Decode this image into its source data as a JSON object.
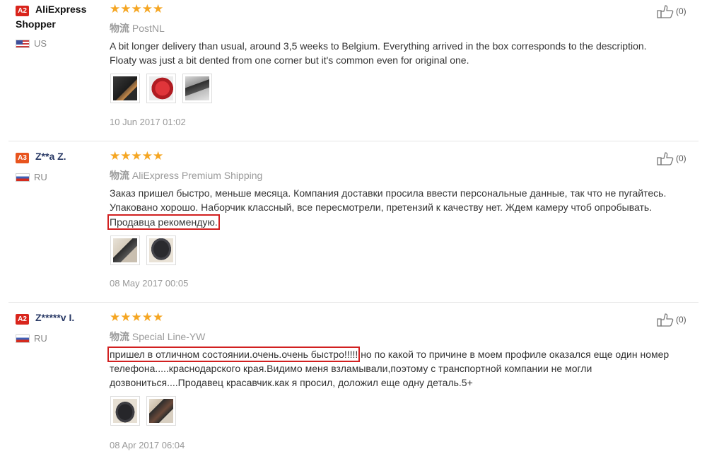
{
  "reviews": [
    {
      "level": "A2",
      "name": "AliExpress",
      "name_line2": "Shopper",
      "country": "US",
      "stars": "★★★★★",
      "shipping_label": "物流",
      "shipping": "PostNL",
      "text_lines": [
        "A bit longer delivery than usual, around 3,5 weeks to Belgium. Everything arrived in the box corresponds to the description.",
        "Floaty was just a bit dented from one corner but it's common even for original one."
      ],
      "date": "10 Jun 2017 01:02",
      "likes": "(0)"
    },
    {
      "level": "A3",
      "name": "Z**a Z.",
      "country": "RU",
      "stars": "★★★★★",
      "shipping_label": "物流",
      "shipping": "AliExpress Premium Shipping",
      "text_lines": [
        "Заказ пришел быстро, меньше месяца. Компания доставки просила ввести персональные данные, так что не пугайтесь.",
        "Упаковано хорошо. Наборчик классный, все пересмотрели, претензий к качеству нет. Ждем камеру чтоб опробывать.",
        "Продавца рекомендую."
      ],
      "date": "08 May 2017 00:05",
      "likes": "(0)"
    },
    {
      "level": "A2",
      "name": "Z*****v I.",
      "country": "RU",
      "stars": "★★★★★",
      "shipping_label": "物流",
      "shipping": "Special Line-YW",
      "text_highlight": "пришел в отличном состоянии.очень.очень быстро!!!!!",
      "text_lines": [
        "но по какой то причине в моем профиле оказался еще один номер",
        "телефона.....краснодарского края.Видимо меня взламывали,поэтому с транспортной компании не могли",
        "дозвониться....Продавец красавчик.как я просил, доложил еще одну деталь.5+"
      ],
      "date": "08 Apr 2017 06:04",
      "likes": "(0)"
    }
  ],
  "icons": {
    "like": "thumbs-up-icon",
    "star": "star-icon",
    "shipping": "shipping-icon"
  },
  "colors": {
    "star": "#f5a623",
    "highlight": "#d12020",
    "level_a2": "#d9251c",
    "level_a3": "#e8541e"
  }
}
